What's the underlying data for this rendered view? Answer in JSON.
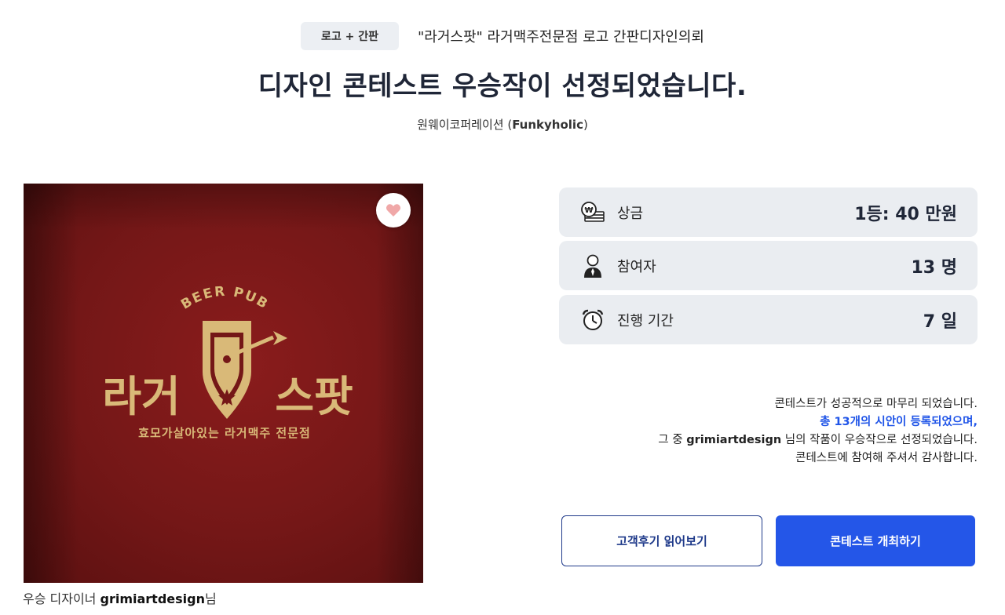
{
  "header": {
    "category_tag": "로고 + 간판",
    "contest_title": "\"라거스팟\" 라거맥주전문점 로고 간판디자인의뢰"
  },
  "main_heading": "디자인 콘테스트 우승작이 선정되었습니다.",
  "client": {
    "company": "원웨이코퍼레이션 (",
    "nickname": "Funkyholic",
    "close": ")"
  },
  "winner_image": {
    "logo_arc": "BEER PUB",
    "logo_left": "라거",
    "logo_right": "스팟",
    "logo_tagline": "효모가살아있는 라거맥주 전문점"
  },
  "designer_caption": {
    "prefix": "우승 디자이너 ",
    "name": "grimiartdesign",
    "suffix": "님"
  },
  "stats": [
    {
      "icon": "money-icon",
      "label": "상금",
      "value": "1등: 40 만원"
    },
    {
      "icon": "person-icon",
      "label": "참여자",
      "value": "13 명"
    },
    {
      "icon": "alarm-clock-icon",
      "label": "진행 기간",
      "value": "7 일"
    }
  ],
  "result": {
    "line1": "콘테스트가 성공적으로 마무리 되었습니다.",
    "line2": "총 13개의 시안이 등록되었으며,",
    "line3_prefix": "그 중 ",
    "line3_name": "grimiartdesign",
    "line3_suffix": " 님의 작품이 우승작으로 선정되었습니다.",
    "line4": "콘테스트에 참여해 주셔서 감사합니다."
  },
  "buttons": {
    "reviews": "고객후기 읽어보기",
    "host_contest": "콘테스트 개최하기"
  },
  "colors": {
    "accent": "#2456e8",
    "highlight_text": "#1f54e8",
    "card_bg": "#eaedf1",
    "logo_bg": "#741717",
    "logo_gold": "#d9b978"
  }
}
